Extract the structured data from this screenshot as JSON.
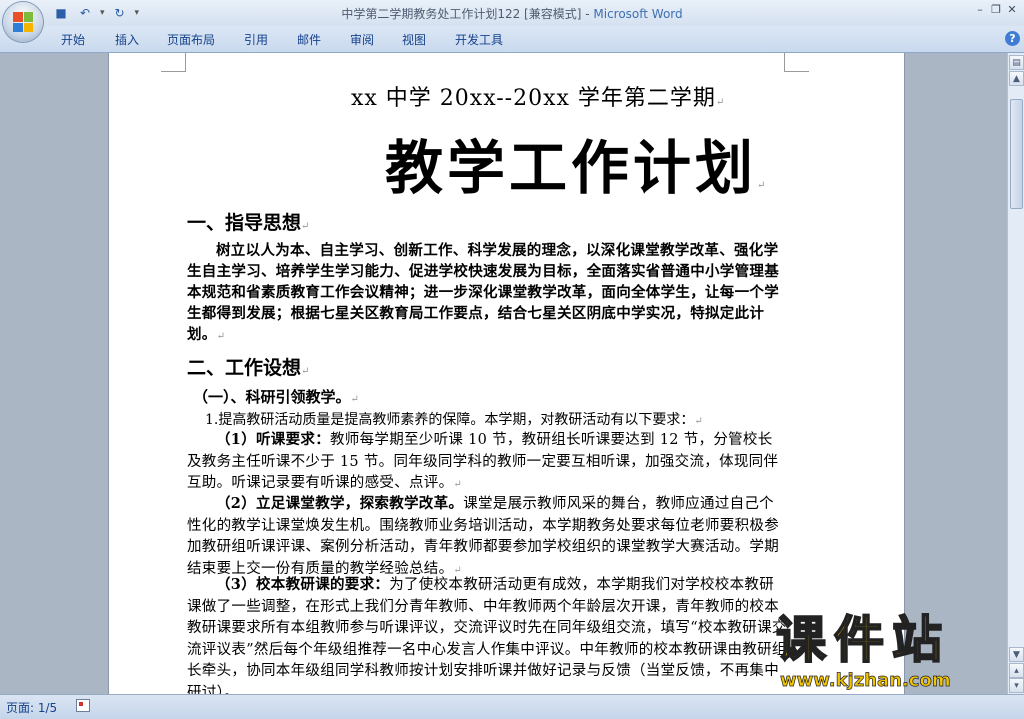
{
  "window": {
    "title_doc": "中学第二学期教务处工作计划122 [兼容模式] - ",
    "title_app": "Microsoft Word"
  },
  "quick_access": {
    "icons": [
      "save-icon",
      "undo-icon",
      "redo-icon",
      "customize-icon"
    ]
  },
  "ribbon": {
    "tabs": [
      "开始",
      "插入",
      "页面布局",
      "引用",
      "邮件",
      "审阅",
      "视图",
      "开发工具"
    ],
    "help": "?"
  },
  "document": {
    "subtitle": "xx 中学 20xx--20xx 学年第二学期",
    "title": "教学工作计划",
    "section1_heading": "一、指导思想",
    "section1_para": "树立以人为本、自主学习、创新工作、科学发展的理念，以深化课堂教学改革、强化学生自主学习、培养学生学习能力、促进学校快速发展为目标，全面落实省普通中小学管理基本规范和省素质教育工作会议精神；进一步深化课堂教学改革，面向全体学生，让每一个学生都得到发展；根据七星关区教育局工作要点，结合七星关区阴底中学实况，特拟定此计划。",
    "section2_heading": "二、工作设想",
    "sub1_heading": "（一）、科研引领教学。",
    "item1": "1.提高教研活动质量是提高教师素养的保障。本学期，对教研活动有以下要求：",
    "p1_lead": "（1）听课要求：",
    "p1_body": "教师每学期至少听课 10 节，教研组长听课要达到 12 节，分管校长及教务主任听课不少于 15 节。同年级同学科的教师一定要互相听课，加强交流，体现同伴互助。听课记录要有听课的感受、点评。",
    "p2_lead": "（2）立足课堂教学，探索教学改革。",
    "p2_body": "课堂是展示教师风采的舞台，教师应通过自己个性化的教学让课堂焕发生机。围绕教师业务培训活动，本学期教务处要求每位老师要积极参加教研组听课评课、案例分析活动，青年教师都要参加学校组织的课堂教学大赛活动。学期结束要上交一份有质量的教学经验总结。",
    "p3_lead": "（3）校本教研课的要求：",
    "p3_body": "为了使校本教研活动更有成效，本学期我们对学校校本教研课做了一些调整，在形式上我们分青年教师、中年教师两个年龄层次开课，青年教师的校本教研课要求所有本组教师参与听课评议，交流评议时先在同年级组交流，填写“校本教研课交流评议表”然后每个年级组推荐一名中心发言人作集中评议。中年教师的校本教研课由教研组长牵头，协同本年级组同学科教师按计划安排听课并做好记录与反馈（当堂反馈，不再集中研讨）。"
  },
  "statusbar": {
    "page": "页面: 1/5"
  },
  "watermark": {
    "text": "课件站",
    "url": "www.kjzhan.com"
  },
  "colors": {
    "accent": "#15428b",
    "app_title": "#3d6fb0",
    "watermark": "#f2c400"
  }
}
